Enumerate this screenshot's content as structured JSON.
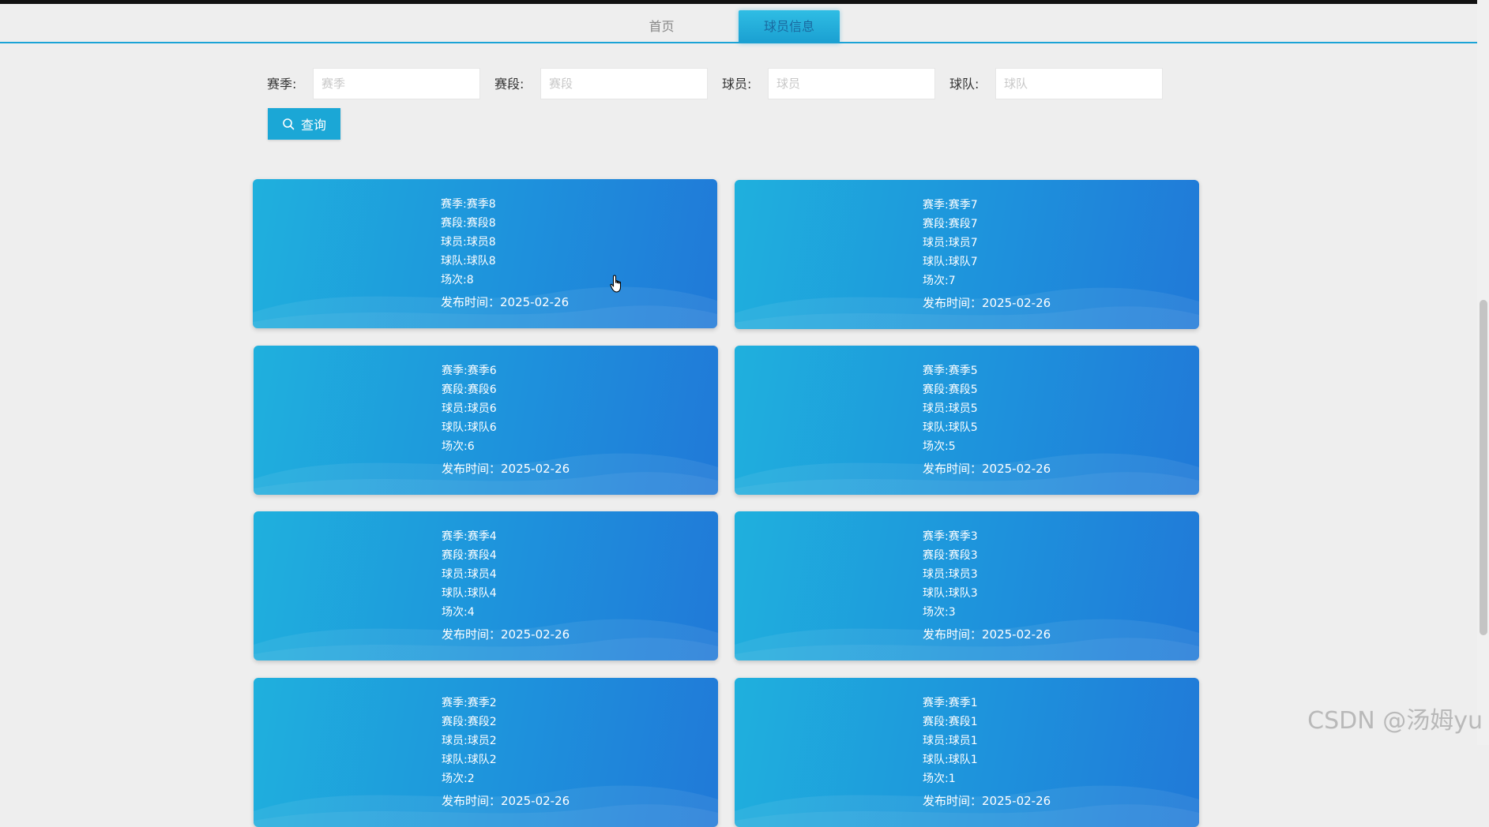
{
  "nav": {
    "tabs": [
      {
        "label": "首页",
        "active": false
      },
      {
        "label": "球员信息",
        "active": true
      }
    ]
  },
  "search": {
    "fields": [
      {
        "label": "赛季:",
        "placeholder": "赛季",
        "value": ""
      },
      {
        "label": "赛段:",
        "placeholder": "赛段",
        "value": ""
      },
      {
        "label": "球员:",
        "placeholder": "球员",
        "value": ""
      },
      {
        "label": "球队:",
        "placeholder": "球队",
        "value": ""
      }
    ],
    "button_label": "查询",
    "button_icon": "search-icon"
  },
  "cards": [
    {
      "lines": [
        "赛季:赛季8",
        "赛段:赛段8",
        "球员:球员8",
        "球队:球队8",
        "场次:8"
      ],
      "time": "发布时间：2025-02-26"
    },
    {
      "lines": [
        "赛季:赛季7",
        "赛段:赛段7",
        "球员:球员7",
        "球队:球队7",
        "场次:7"
      ],
      "time": "发布时间：2025-02-26"
    },
    {
      "lines": [
        "赛季:赛季6",
        "赛段:赛段6",
        "球员:球员6",
        "球队:球队6",
        "场次:6"
      ],
      "time": "发布时间：2025-02-26"
    },
    {
      "lines": [
        "赛季:赛季5",
        "赛段:赛段5",
        "球员:球员5",
        "球队:球队5",
        "场次:5"
      ],
      "time": "发布时间：2025-02-26"
    },
    {
      "lines": [
        "赛季:赛季4",
        "赛段:赛段4",
        "球员:球员4",
        "球队:球队4",
        "场次:4"
      ],
      "time": "发布时间：2025-02-26"
    },
    {
      "lines": [
        "赛季:赛季3",
        "赛段:赛段3",
        "球员:球员3",
        "球队:球队3",
        "场次:3"
      ],
      "time": "发布时间：2025-02-26"
    },
    {
      "lines": [
        "赛季:赛季2",
        "赛段:赛段2",
        "球员:球员2",
        "球队:球队2",
        "场次:2"
      ],
      "time": "发布时间：2025-02-26"
    },
    {
      "lines": [
        "赛季:赛季1",
        "赛段:赛段1",
        "球员:球员1",
        "球队:球队1",
        "场次:1"
      ],
      "time": "发布时间：2025-02-26"
    }
  ],
  "watermark": "CSDN @汤姆yu",
  "colors": {
    "accent": "#1ba7d6",
    "card_start": "#1fb0dd",
    "card_end": "#2079d8"
  }
}
